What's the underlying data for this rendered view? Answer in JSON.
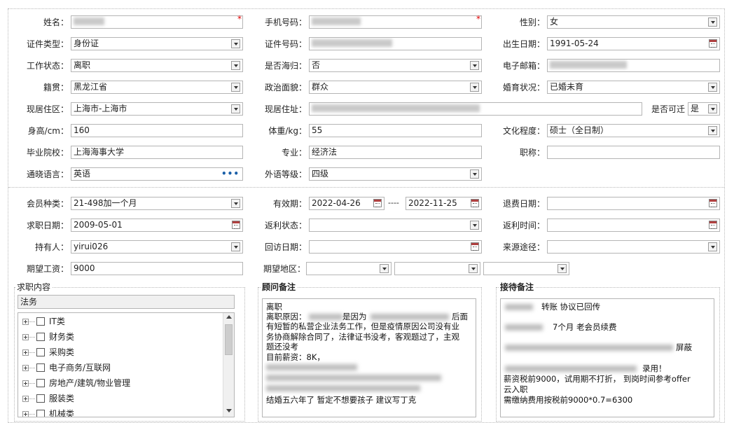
{
  "form": {
    "name": {
      "label": "姓名：",
      "required_mark": "*"
    },
    "phone": {
      "label": "手机号码：",
      "required_mark": "*"
    },
    "gender": {
      "label": "性别：",
      "value": "女"
    },
    "id_type": {
      "label": "证件类型：",
      "value": "身份证"
    },
    "id_number": {
      "label": "证件号码："
    },
    "birth_date": {
      "label": "出生日期：",
      "value": "1991-05-24"
    },
    "work_status": {
      "label": "工作状态：",
      "value": "离职"
    },
    "returnee": {
      "label": "是否海归：",
      "value": "否"
    },
    "email": {
      "label": "电子邮箱："
    },
    "native_place": {
      "label": "籍贯：",
      "value": "黑龙江省"
    },
    "political_status": {
      "label": "政治面貌：",
      "value": "群众"
    },
    "marital_status": {
      "label": "婚育状况：",
      "value": "已婚未育"
    },
    "residence_area": {
      "label": "现居住区：",
      "value": "上海市-上海市"
    },
    "residence_address": {
      "label": "现居住址："
    },
    "relocatable": {
      "label": "是否可迁",
      "value": "是"
    },
    "height": {
      "label": "身高/cm：",
      "value": "160"
    },
    "weight": {
      "label": "体重/kg：",
      "value": "55"
    },
    "education": {
      "label": "文化程度：",
      "value": "硕士（全日制）"
    },
    "school": {
      "label": "毕业院校：",
      "value": "上海海事大学"
    },
    "major": {
      "label": "专业：",
      "value": "经济法"
    },
    "title": {
      "label": "职称："
    },
    "language": {
      "label": "通晓语言：",
      "value": "英语",
      "more": "•••"
    },
    "language_level": {
      "label": "外语等级：",
      "value": "四级"
    }
  },
  "membership": {
    "member_type": {
      "label": "会员种类：",
      "value": "21-498加一个月"
    },
    "valid_period": {
      "label": "有效期：",
      "start": "2022-04-26",
      "separator": "----",
      "end": "2022-11-25"
    },
    "refund_date": {
      "label": "退费日期："
    },
    "job_date": {
      "label": "求职日期：",
      "value": "2009-05-01"
    },
    "rebate_status": {
      "label": "返利状态："
    },
    "rebate_time": {
      "label": "返利时间："
    },
    "holder": {
      "label": "持有人：",
      "value": "yirui026"
    },
    "visit_date": {
      "label": "回访日期："
    },
    "source": {
      "label": "来源途径："
    },
    "expected_salary": {
      "label": "期望工资：",
      "value": "9000"
    },
    "expected_region": {
      "label": "期望地区："
    }
  },
  "job_content": {
    "title": "求职内容",
    "selected": "法务",
    "categories": [
      "IT类",
      "财务类",
      "采购类",
      "电子商务/互联网",
      "房地产/建筑/物业管理",
      "服装类",
      "机械类"
    ]
  },
  "advisor_notes": {
    "title": "顾问备注",
    "lines": [
      "离职",
      "离职原因：",
      "是因为",
      "后面",
      "有短暂的私营企业法务工作，但是疫情原因公司没有业",
      "务协商解除合同了，法律证书没考，客观题过了，主观",
      "题还没考",
      "目前薪资：8K，",
      "结婚五六年了 暂定不想要孩子  建议写丁克"
    ]
  },
  "reception_notes": {
    "title": "接待备注",
    "lines": [
      "转账 协议已回传",
      "7个月 老会员续费",
      "屏蔽",
      "录用！",
      "薪资税前9000，试用期不打折， 到岗时间参考offer",
      "云入职",
      "需缴纳费用按税前9000*0.7=6300"
    ]
  },
  "icons": {
    "dropdown": "chevron-down-icon",
    "calendar": "calendar-icon",
    "expand": "plus-icon"
  }
}
